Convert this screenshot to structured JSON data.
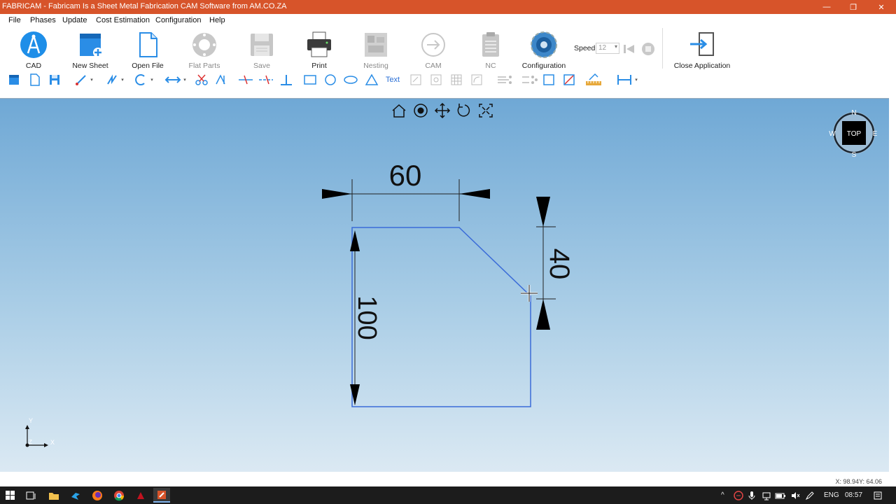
{
  "window": {
    "title": "FABRICAM - Fabricam Is a Sheet Metal Fabrication CAM Software from AM.CO.ZA",
    "titlebar_color": "#d7542a"
  },
  "menu": [
    "File",
    "Phases",
    "Update",
    "Cost Estimation",
    "Configuration",
    "Help"
  ],
  "ribbon": {
    "cad": "CAD",
    "new_sheet": "New Sheet",
    "open_file": "Open File",
    "flat_parts": "Flat Parts",
    "save": "Save",
    "print": "Print",
    "nesting": "Nesting",
    "cam": "CAM",
    "nc": "NC",
    "configuration": "Configuration",
    "speed_label": "Speed",
    "speed_value": "12",
    "close_application": "Close Application"
  },
  "toolbar": {
    "text_tool": "Text"
  },
  "viewport": {
    "dimensions": {
      "width": "60",
      "height": "100",
      "chamfer": "40"
    },
    "compass": {
      "center": "TOP",
      "n": "N",
      "s": "S",
      "e": "E",
      "w": "W"
    },
    "axes": {
      "x": "X",
      "y": "Y",
      "z": "Z"
    }
  },
  "status": {
    "coordinates": "X: 98.94Y: 64.06"
  },
  "taskbar": {
    "language": "ENG",
    "time": "08:57"
  }
}
